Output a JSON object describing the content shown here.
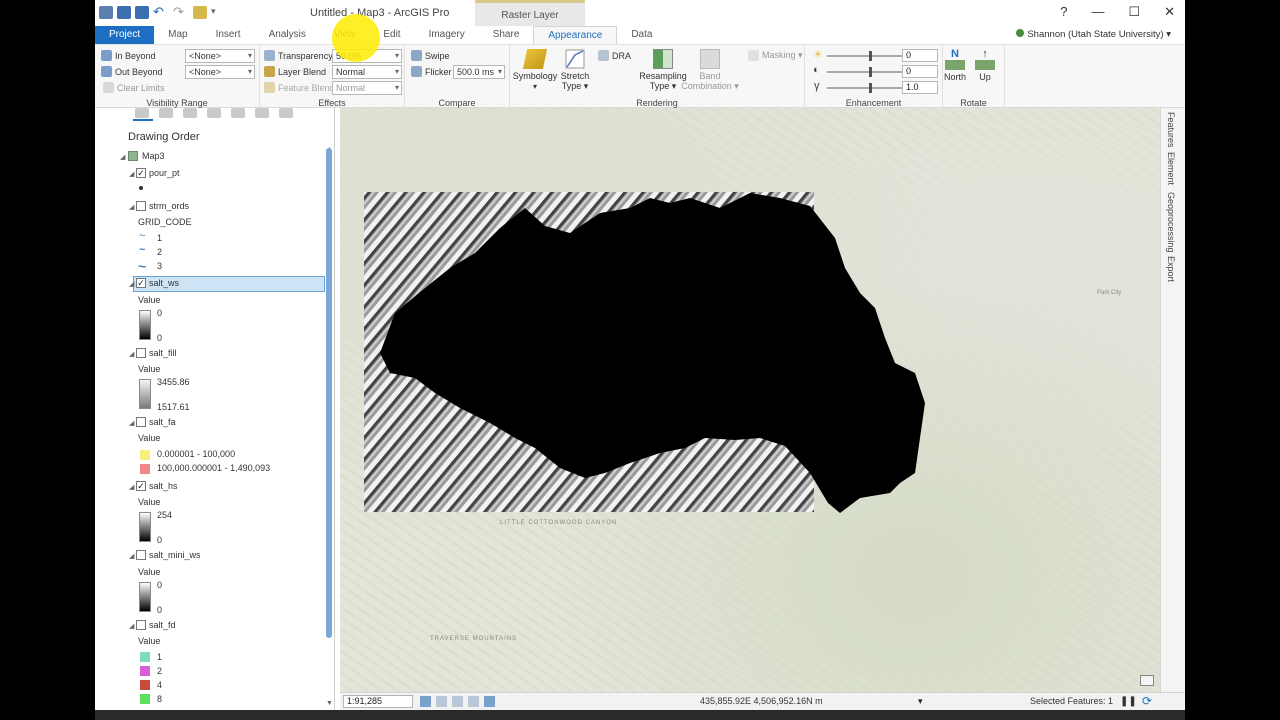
{
  "window": {
    "title": "Untitled - Map3 - ArcGIS Pro",
    "context_tab": "Raster Layer",
    "help": "?",
    "minimize": "—",
    "maximize": "☐",
    "close": "✕"
  },
  "tabs": [
    "Project",
    "Map",
    "Insert",
    "Analysis",
    "View",
    "Edit",
    "Imagery",
    "Share",
    "Appearance",
    "Data"
  ],
  "user": "Shannon (Utah State University) ▾",
  "ribbon": {
    "visibility": {
      "label": "Visibility Range",
      "in_beyond": "In Beyond",
      "out_beyond": "Out Beyond",
      "clear_limits": "Clear Limits",
      "in_value": "<None>",
      "out_value": "<None>"
    },
    "effects": {
      "label": "Effects",
      "transparency": "Transparency",
      "transparency_value": "50.0%",
      "layer_blend": "Layer Blend",
      "layer_blend_value": "Normal",
      "feature_blend": "Feature Blend",
      "feature_blend_value": "Normal"
    },
    "compare": {
      "label": "Compare",
      "swipe": "Swipe",
      "flicker": "Flicker",
      "flicker_value": "500.0 ms"
    },
    "rendering": {
      "label": "Rendering",
      "dra": "DRA",
      "symbology": "Symbology",
      "stretch": "Stretch",
      "stretch_sub": "Type ▾",
      "resampling": "Resampling",
      "resampling_sub": "Type ▾",
      "band": "Band",
      "band_sub": "Combination ▾",
      "masking": "Masking ▾"
    },
    "enhancement": {
      "label": "Enhancement",
      "brightness": "0",
      "contrast": "0",
      "gamma": "1.0"
    },
    "rotate": {
      "label": "Rotate",
      "north": "North",
      "up": "Up"
    }
  },
  "contents": {
    "heading": "Drawing Order",
    "map_name": "Map3",
    "layers": [
      {
        "name": "pour_pt",
        "checked": true
      },
      {
        "name": "strm_ords",
        "checked": false,
        "field": "GRID_CODE",
        "classes": [
          "1",
          "2",
          "3"
        ]
      },
      {
        "name": "salt_ws",
        "checked": true,
        "selected": true,
        "legend_title": "Value",
        "high": "0",
        "low": "0"
      },
      {
        "name": "salt_fill",
        "checked": false,
        "legend_title": "Value",
        "high": "3455.86",
        "low": "1517.61"
      },
      {
        "name": "salt_fa",
        "checked": false,
        "legend_title": "Value",
        "classes": [
          "0.000001 - 100,000",
          "100,000.000001 - 1,490,093"
        ]
      },
      {
        "name": "salt_hs",
        "checked": true,
        "legend_title": "Value",
        "high": "254",
        "low": "0"
      },
      {
        "name": "salt_mini_ws",
        "checked": false,
        "legend_title": "Value",
        "high": "0",
        "low": "0"
      },
      {
        "name": "salt_fd",
        "checked": false,
        "legend_title": "Value",
        "classes": [
          "1",
          "2",
          "4",
          "8"
        ]
      }
    ]
  },
  "colors": {
    "fa_low": "#f5f07a",
    "fa_high": "#f08a8a",
    "fd_1": "#7fdcc0",
    "fd_2": "#d85fd8",
    "fd_4": "#c84a3a",
    "fd_8": "#5ee05e",
    "accent": "#1c6fc2"
  },
  "map_labels": {
    "canyon": "LITTLE COTTONWOOD CANYON",
    "mountains": "TRAVERSE MOUNTAINS",
    "city": "Park City"
  },
  "side_tabs": [
    "Features",
    "Element",
    "Geoprocessing",
    "Export"
  ],
  "status": {
    "scale": "1:91,285",
    "coords": "435,855.92E 4,506,952.16N m",
    "selected_features": "Selected Features: 1"
  }
}
